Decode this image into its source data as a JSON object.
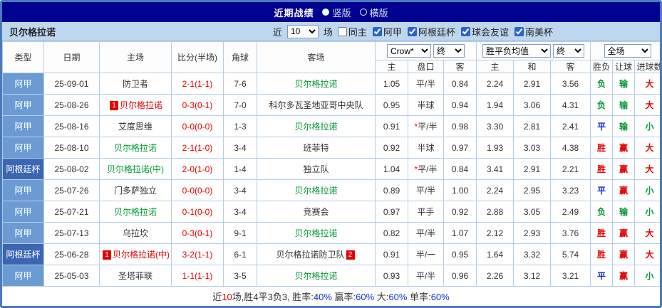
{
  "titlebar": {
    "title": "近期战绩",
    "radios": [
      {
        "label": "竖版",
        "selected": true
      },
      {
        "label": "横版",
        "selected": false
      }
    ]
  },
  "filterbar": {
    "team": "贝尔格拉诺",
    "recent_prefix": "近",
    "recent_count": "10",
    "recent_suffix": "场",
    "checkboxes": [
      {
        "label": "同主",
        "checked": false
      },
      {
        "label": "阿甲",
        "checked": true
      },
      {
        "label": "阿根廷杯",
        "checked": true
      },
      {
        "label": "球会友谊",
        "checked": true
      },
      {
        "label": "南美杯",
        "checked": true
      }
    ]
  },
  "table": {
    "headers": {
      "type": "类型",
      "date": "日期",
      "home": "主场",
      "score": "比分(半场)",
      "corner": "角球",
      "away": "客场",
      "odds_company": "Crow*",
      "odds_final": "终",
      "odds_sub": [
        "主",
        "盘口",
        "客"
      ],
      "avg_label": "胜平负均值",
      "avg_final": "终",
      "avg_sub": [
        "主",
        "和",
        "客"
      ],
      "result_label": "全场",
      "result_sub": [
        "胜负",
        "让球",
        "进球数"
      ]
    },
    "rows": [
      {
        "league": "阿甲",
        "cup": false,
        "date": "25-09-01",
        "home": "防卫者",
        "home_color": "black",
        "home_card": "",
        "score": "2-1(1-1)",
        "corners": "7-6",
        "away": "贝尔格拉诺",
        "away_color": "green",
        "away_card": "",
        "odds_home": "1.05",
        "handicap": "平/半",
        "handicap_star": false,
        "odds_away": "0.84",
        "avg_home": "2.24",
        "avg_draw": "2.91",
        "avg_away": "3.56",
        "wdl": "负",
        "wdl_color": "green",
        "ht": "输",
        "ht_color": "green",
        "goal": "大",
        "goal_color": "red"
      },
      {
        "league": "阿甲",
        "cup": false,
        "date": "25-08-26",
        "home": "贝尔格拉诺",
        "home_color": "red",
        "home_card": "1",
        "score": "0-3(0-1)",
        "corners": "7-0",
        "away": "科尔多瓦圣地亚哥中央队",
        "away_color": "black",
        "away_card": "",
        "odds_home": "0.95",
        "handicap": "半球",
        "handicap_star": false,
        "odds_away": "0.94",
        "avg_home": "1.94",
        "avg_draw": "3.06",
        "avg_away": "4.31",
        "wdl": "负",
        "wdl_color": "green",
        "ht": "输",
        "ht_color": "green",
        "goal": "大",
        "goal_color": "red"
      },
      {
        "league": "阿甲",
        "cup": false,
        "date": "25-08-16",
        "home": "艾度思维",
        "home_color": "black",
        "home_card": "",
        "score": "0-0(0-0)",
        "corners": "1-3",
        "away": "贝尔格拉诺",
        "away_color": "green",
        "away_card": "",
        "odds_home": "0.91",
        "handicap": "平/半",
        "handicap_star": true,
        "odds_away": "0.98",
        "avg_home": "3.30",
        "avg_draw": "2.81",
        "avg_away": "2.41",
        "wdl": "平",
        "wdl_color": "blue",
        "ht": "输",
        "ht_color": "green",
        "goal": "小",
        "goal_color": "green"
      },
      {
        "league": "阿甲",
        "cup": false,
        "date": "25-08-10",
        "home": "贝尔格拉诺",
        "home_color": "green",
        "home_card": "",
        "score": "2-1(1-0)",
        "corners": "3-4",
        "away": "班菲特",
        "away_color": "black",
        "away_card": "",
        "odds_home": "0.92",
        "handicap": "半球",
        "handicap_star": false,
        "odds_away": "0.97",
        "avg_home": "1.93",
        "avg_draw": "3.03",
        "avg_away": "4.38",
        "wdl": "胜",
        "wdl_color": "red",
        "ht": "赢",
        "ht_color": "red",
        "goal": "大",
        "goal_color": "red"
      },
      {
        "league": "阿根廷杯",
        "cup": true,
        "date": "25-08-02",
        "home": "贝尔格拉诺(中)",
        "home_color": "green",
        "home_card": "",
        "score": "2-0(1-0)",
        "corners": "1-4",
        "away": "独立队",
        "away_color": "black",
        "away_card": "",
        "odds_home": "1.04",
        "handicap": "平/半",
        "handicap_star": true,
        "odds_away": "0.84",
        "avg_home": "3.41",
        "avg_draw": "2.91",
        "avg_away": "2.21",
        "wdl": "胜",
        "wdl_color": "red",
        "ht": "赢",
        "ht_color": "red",
        "goal": "大",
        "goal_color": "red"
      },
      {
        "league": "阿甲",
        "cup": false,
        "date": "25-07-26",
        "home": "门多萨独立",
        "home_color": "black",
        "home_card": "",
        "score": "0-0(0-0)",
        "corners": "3-4",
        "away": "贝尔格拉诺",
        "away_color": "green",
        "away_card": "",
        "odds_home": "0.89",
        "handicap": "平/半",
        "handicap_star": false,
        "odds_away": "1.00",
        "avg_home": "2.24",
        "avg_draw": "2.95",
        "avg_away": "3.23",
        "wdl": "平",
        "wdl_color": "blue",
        "ht": "赢",
        "ht_color": "red",
        "goal": "小",
        "goal_color": "green"
      },
      {
        "league": "阿甲",
        "cup": false,
        "date": "25-07-21",
        "home": "贝尔格拉诺",
        "home_color": "green",
        "home_card": "",
        "score": "0-1(0-0)",
        "corners": "3-4",
        "away": "竞赛会",
        "away_color": "black",
        "away_card": "",
        "odds_home": "0.97",
        "handicap": "平手",
        "handicap_star": false,
        "odds_away": "0.92",
        "avg_home": "2.88",
        "avg_draw": "3.05",
        "avg_away": "2.49",
        "wdl": "负",
        "wdl_color": "green",
        "ht": "输",
        "ht_color": "green",
        "goal": "小",
        "goal_color": "green"
      },
      {
        "league": "阿甲",
        "cup": false,
        "date": "25-07-13",
        "home": "乌拉坎",
        "home_color": "black",
        "home_card": "",
        "score": "0-3(0-1)",
        "corners": "9-1",
        "away": "贝尔格拉诺",
        "away_color": "green",
        "away_card": "",
        "odds_home": "0.82",
        "handicap": "平/半",
        "handicap_star": false,
        "odds_away": "1.07",
        "avg_home": "2.12",
        "avg_draw": "2.93",
        "avg_away": "3.76",
        "wdl": "胜",
        "wdl_color": "red",
        "ht": "赢",
        "ht_color": "red",
        "goal": "大",
        "goal_color": "red"
      },
      {
        "league": "阿根廷杯",
        "cup": true,
        "date": "25-06-28",
        "home": "贝尔格拉诺(中)",
        "home_color": "red",
        "home_card": "1",
        "score": "3-2(1-1)",
        "corners": "6-1",
        "away": "贝尔格拉诺防卫队",
        "away_color": "black",
        "away_card": "2",
        "odds_home": "0.91",
        "handicap": "半/一",
        "handicap_star": false,
        "odds_away": "0.95",
        "avg_home": "1.64",
        "avg_draw": "3.32",
        "avg_away": "5.74",
        "wdl": "胜",
        "wdl_color": "red",
        "ht": "赢",
        "ht_color": "red",
        "goal": "大",
        "goal_color": "red"
      },
      {
        "league": "阿甲",
        "cup": false,
        "date": "25-05-03",
        "home": "圣塔菲联",
        "home_color": "black",
        "home_card": "",
        "score": "1-1(1-1)",
        "corners": "3-5",
        "away": "贝尔格拉诺",
        "away_color": "green",
        "away_card": "",
        "odds_home": "0.93",
        "handicap": "平/半",
        "handicap_star": false,
        "odds_away": "0.96",
        "avg_home": "2.26",
        "avg_draw": "3.12",
        "avg_away": "3.21",
        "wdl": "平",
        "wdl_color": "blue",
        "ht": "赢",
        "ht_color": "red",
        "goal": "小",
        "goal_color": "green"
      }
    ]
  },
  "summary": {
    "segments": [
      {
        "text": "近",
        "color": "black"
      },
      {
        "text": "10",
        "color": "red"
      },
      {
        "text": "场,胜4平3负3, 胜率:",
        "color": "black"
      },
      {
        "text": "40%",
        "color": "blue"
      },
      {
        "text": " 赢率:",
        "color": "black"
      },
      {
        "text": "60%",
        "color": "blue"
      },
      {
        "text": " 大:",
        "color": "black"
      },
      {
        "text": "60%",
        "color": "blue"
      },
      {
        "text": " 单率:",
        "color": "black"
      },
      {
        "text": "60%",
        "color": "blue"
      }
    ]
  },
  "colors": {
    "accent_navy": "#000090",
    "filter_bg": "#bed6ee",
    "league_cell": "#6b9bd3",
    "cup_cell": "#3c66b4",
    "win_red": "#e60000",
    "lose_green": "#009933",
    "draw_blue": "#1133cc"
  }
}
